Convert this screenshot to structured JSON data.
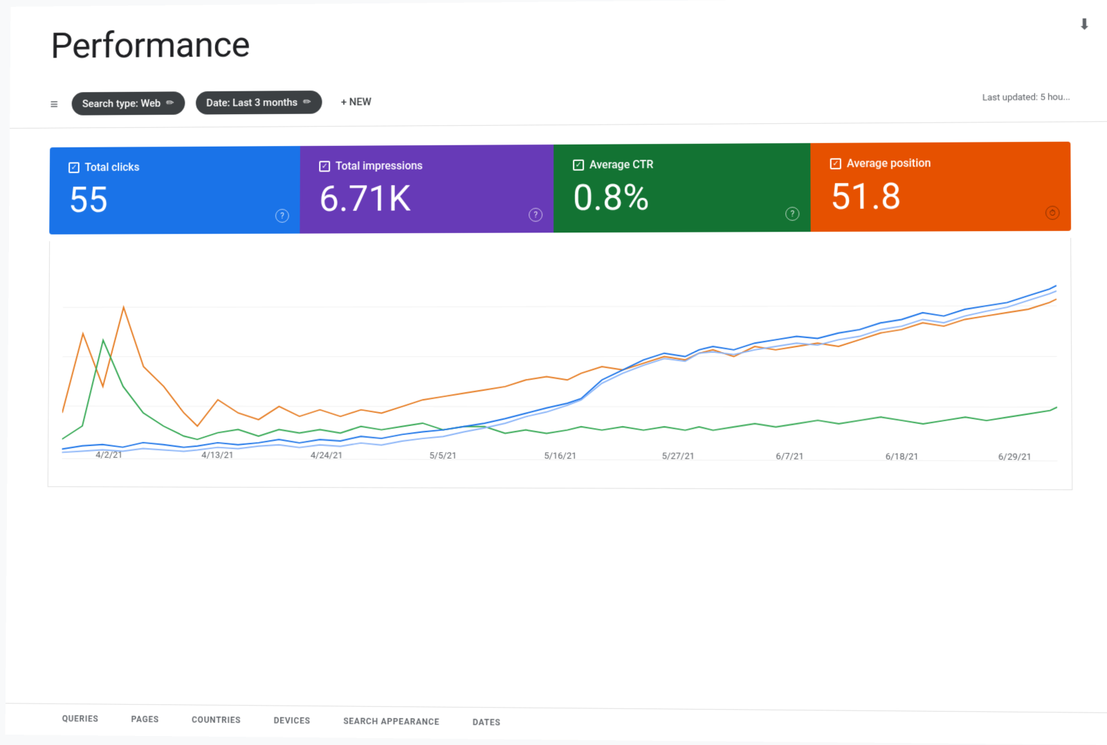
{
  "page": {
    "title": "Performance",
    "last_updated": "Last updated: 5 hou..."
  },
  "filters": {
    "filter_icon_label": "≡",
    "chips": [
      {
        "id": "search-type",
        "label": "Search type: Web",
        "edit_icon": "✏"
      },
      {
        "id": "date-range",
        "label": "Date: Last 3 months",
        "edit_icon": "✏"
      }
    ],
    "new_button_label": "+ NEW"
  },
  "metrics": [
    {
      "id": "total-clicks",
      "label": "Total clicks",
      "value": "55",
      "color": "#1a73e8",
      "class": "clicks"
    },
    {
      "id": "total-impressions",
      "label": "Total impressions",
      "value": "6.71K",
      "color": "#673ab7",
      "class": "impressions"
    },
    {
      "id": "average-ctr",
      "label": "Average CTR",
      "value": "0.8%",
      "color": "#137333",
      "class": "ctr"
    },
    {
      "id": "average-position",
      "label": "Average position",
      "value": "51.8",
      "color": "#e65100",
      "class": "position"
    }
  ],
  "chart": {
    "x_labels": [
      "4/2/21",
      "4/13/21",
      "4/24/21",
      "5/5/21",
      "5/16/21",
      "5/27/21",
      "6/7/21",
      "6/18/21",
      "6/29/21"
    ],
    "series": [
      {
        "name": "Total clicks",
        "color": "#1a73e8"
      },
      {
        "name": "Total impressions",
        "color": "#8ab4f8"
      },
      {
        "name": "Average CTR",
        "color": "#e67c22"
      },
      {
        "name": "Average position",
        "color": "#34a853"
      }
    ]
  },
  "bottom_tabs": [
    {
      "id": "queries",
      "label": "QUERIES"
    },
    {
      "id": "pages",
      "label": "PAGES"
    },
    {
      "id": "countries",
      "label": "COUNTRIES"
    },
    {
      "id": "devices",
      "label": "DEVICES"
    },
    {
      "id": "search-appearance",
      "label": "SEARCH APPEARANCE"
    },
    {
      "id": "dates",
      "label": "DATES"
    }
  ]
}
